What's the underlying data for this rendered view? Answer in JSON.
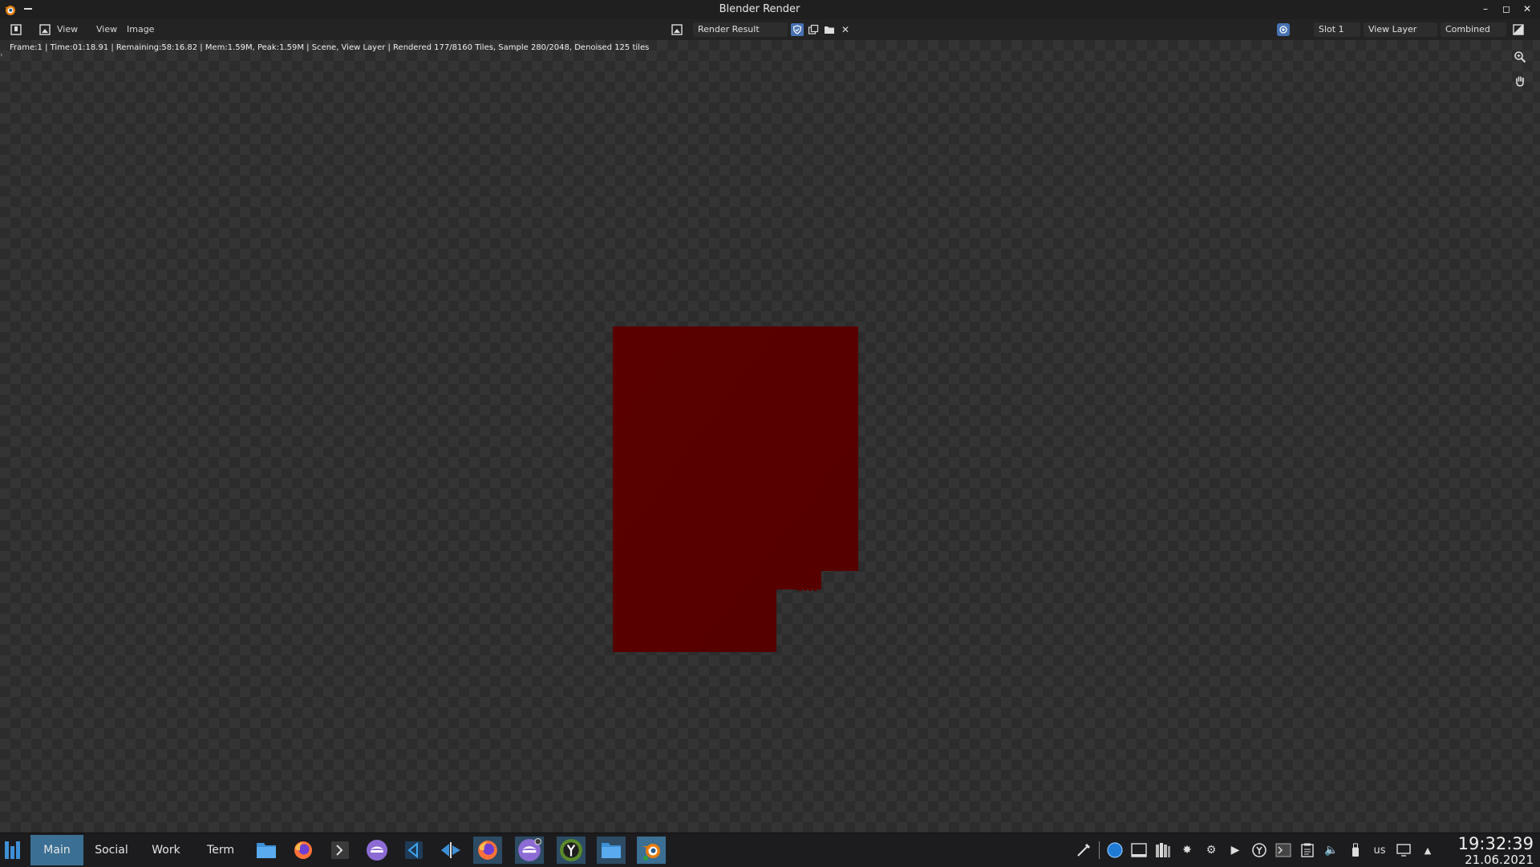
{
  "window": {
    "title": "Blender Render"
  },
  "header": {
    "editor_view_label": "View",
    "menus": [
      "View",
      "Image"
    ],
    "image_name": "Render Result",
    "slot": "Slot 1",
    "view_layer": "View Layer",
    "pass": "Combined"
  },
  "viewport": {
    "stats": "Frame:1 | Time:01:18.91 | Remaining:58:16.82 | Mem:1.59M, Peak:1.59M | Scene, View Layer | Rendered 177/8160 Tiles, Sample 280/2048, Denoised 125 tiles",
    "render_color": "#5e0000"
  },
  "taskbar": {
    "tabs": [
      "Main",
      "Social",
      "Work",
      "Term"
    ],
    "active_tab": "Main",
    "apps": [
      "file-manager-icon",
      "firefox-icon",
      "terminal-icon",
      "signal-icon",
      "vscode-icon",
      "kdeconnect-icon",
      "firefox-icon",
      "signal-icon",
      "keepass-icon",
      "file-manager-icon",
      "blender-icon"
    ],
    "tray": [
      "color-picker-icon",
      "circle-app-icon",
      "window-icon",
      "library-icon",
      "bug-icon",
      "update-icon",
      "media-icon",
      "keepassxc-icon",
      "terminal-icon",
      "clipboard-icon",
      "volume-icon",
      "usb-icon",
      "display-icon",
      "arrow-up-icon"
    ],
    "keyboard_layout": "us",
    "time": "19:32:39",
    "date": "21.06.2021"
  },
  "colors": {
    "accent": "#3b6f93",
    "render_red": "#5e0000"
  }
}
